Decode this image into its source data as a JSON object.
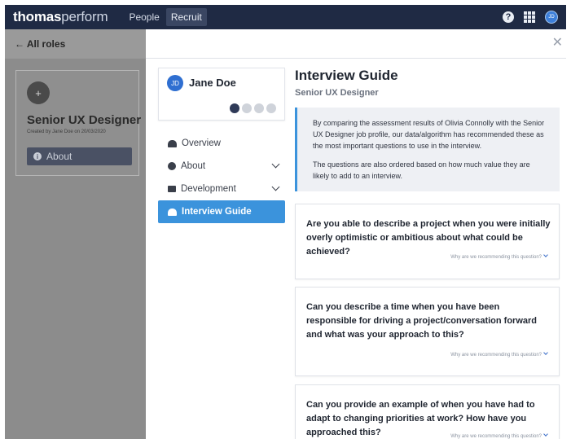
{
  "topbar": {
    "brand_bold": "thomas",
    "brand_light": "perform",
    "nav": [
      "People",
      "Recruit"
    ],
    "help_icon": "question-icon",
    "apps_icon": "grid-icon",
    "user_initials": "JD"
  },
  "left": {
    "back_label": "← All roles",
    "role": {
      "title": "Senior UX Designer",
      "created": "Created by Jane Doe on 20/03/2020",
      "about_label": "About"
    }
  },
  "person": {
    "initials": "JD",
    "name": "Jane Doe"
  },
  "side_nav": {
    "items": [
      {
        "label": "Overview",
        "icon": "user-icon"
      },
      {
        "label": "About",
        "icon": "info-icon"
      },
      {
        "label": "Development",
        "icon": "plant-icon"
      },
      {
        "label": "Interview Guide",
        "icon": "chat-icon"
      }
    ]
  },
  "guide": {
    "title": "Interview Guide",
    "subtitle": "Senior UX Designer",
    "info_p1": "By comparing the assessment results of Olivia Connolly with the Senior UX Designer job profile, our data/algorithm has recommended these as the most important questions to use in the interview.",
    "info_p2": "The questions are also ordered based on how much value they are likely to add to an interview.",
    "why_label": "Why are we recommending this question?",
    "questions": [
      "Are you able to describe a project when you were initially overly optimistic or ambitious about what could be achieved?",
      "Can you describe a time when you have been responsible for driving a project/conversation forward and what was your approach to this?",
      "Can you provide an example of when you have had to adapt to changing priorities at work? How have you approached this?"
    ]
  },
  "colors": {
    "nav_bg": "#1f2a44",
    "accent": "#3b93dc",
    "overlay_grey": "#8c8c8c"
  }
}
